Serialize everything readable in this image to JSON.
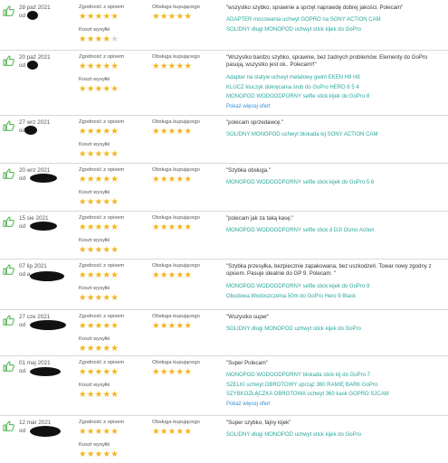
{
  "labels": {
    "item_desc": "Zgodność z opisem",
    "shipping": "Koszt wysyłki",
    "service": "Obsługa kupującego",
    "from_prefix": "od"
  },
  "colors": {
    "star_on": "#f3b41c",
    "star_off": "#d2d2d2",
    "link": "#2aa89d",
    "more_link": "#3a8fd1",
    "thumb": "#5cb85c"
  },
  "reviews": [
    {
      "date": "28 paź 2021",
      "user_hint": "od a",
      "item_desc": 5,
      "shipping": 4,
      "service": 5,
      "comment": "\"wszystko szybko, sprawnie a sprzęt naprawdę dobrej jakości. Polecam\"",
      "items": [
        "ADAPTER mocowania uchwyt GOPRO na SONY ACTION CAM",
        "SOLIDNY długi MONOPOD uchwyt stick kijek do GoPro"
      ],
      "more": ""
    },
    {
      "date": "20 paź 2021",
      "user_hint": "od k",
      "item_desc": 5,
      "shipping": 5,
      "service": 5,
      "comment": "\"Wszystko bardzo szybko, sprawnie, bez żadnych problemów. Elementy do GoPro pasują, wszystko jest ok.. Polecam!!\"",
      "items": [
        "Adapter na statyw uchwyt metalowy gwint EKEN H9 H8",
        "KLUCZ kluczyk dokręcania śrub do GoPro HERO 6 5 4",
        "MONOPOD WODOODPORNY selfie stick kijek do GoPro 8"
      ],
      "more": "Pokaż więcej ofert"
    },
    {
      "date": "27 wrz 2021",
      "user_hint": "od A",
      "item_desc": 5,
      "shipping": 5,
      "service": 5,
      "comment": "\"polecam sprzedawcę.\"",
      "items": [
        "SOLIDNY MONOPOD uchwyt blokada kij SONY ACTION CAM"
      ],
      "more": ""
    },
    {
      "date": "20 wrz 2021",
      "user_hint": "od",
      "item_desc": 5,
      "shipping": 5,
      "service": 5,
      "comment": "\"Szybka obsługa.\"",
      "items": [
        "MONOPOD WODOODPORNY selfie stick kijek do GoPro 5 6"
      ],
      "more": ""
    },
    {
      "date": "15 sie 2021",
      "user_hint": "od",
      "item_desc": 5,
      "shipping": 5,
      "service": 5,
      "comment": "\"polecam jak za taką kasę.\"",
      "items": [
        "MONOPOD WODOODPORNY selfie stick d DJI Osmo Action"
      ],
      "more": ""
    },
    {
      "date": "07 lip 2021",
      "user_hint": "od a",
      "item_desc": 5,
      "shipping": 5,
      "service": 5,
      "comment": "\"Szybka przesyłka, bezpiecznie zapakowana, bez uszkodzeń. Towar nowy zgodny z opisem. Pasuje idealnie do GP 9. Polecam. \"",
      "items": [
        "MONOPOD WODOODPORNY selfie stick kijek do GoPro 9",
        "Obudowa Wodoszczelna 50m do GoPro Hero 9 Black"
      ],
      "more": ""
    },
    {
      "date": "27 cze 2021",
      "user_hint": "od",
      "item_desc": 5,
      "shipping": 5,
      "service": 5,
      "comment": "\"Wszystko super\"",
      "items": [
        "SOLIDNY długi MONOPOD uchwyt stick kijek do GoPro"
      ],
      "more": ""
    },
    {
      "date": "01 maj 2021",
      "user_hint": "od",
      "item_desc": 5,
      "shipping": 5,
      "service": 5,
      "comment": "\"Super Polecam\"",
      "items": [
        "MONOPOD WODOODPORNY blokada stick kij do GoPro 7",
        "SZELKI uchwyt OBROTOWY uprząż 360 RAMIĘ BARK GoPro",
        "SZYBKOZŁĄCZKA OBROTOWA uchwyt 360 kask GOPRO SJCAM"
      ],
      "more": "Pokaż więcej ofert"
    },
    {
      "date": "12 mar 2021",
      "user_hint": "od",
      "item_desc": 5,
      "shipping": 5,
      "service": 5,
      "comment": "\"Super szybko, fajny kijek\"",
      "items": [
        "SOLIDNY długi MONOPOD uchwyt stick kijek do GoPro"
      ],
      "more": ""
    }
  ]
}
